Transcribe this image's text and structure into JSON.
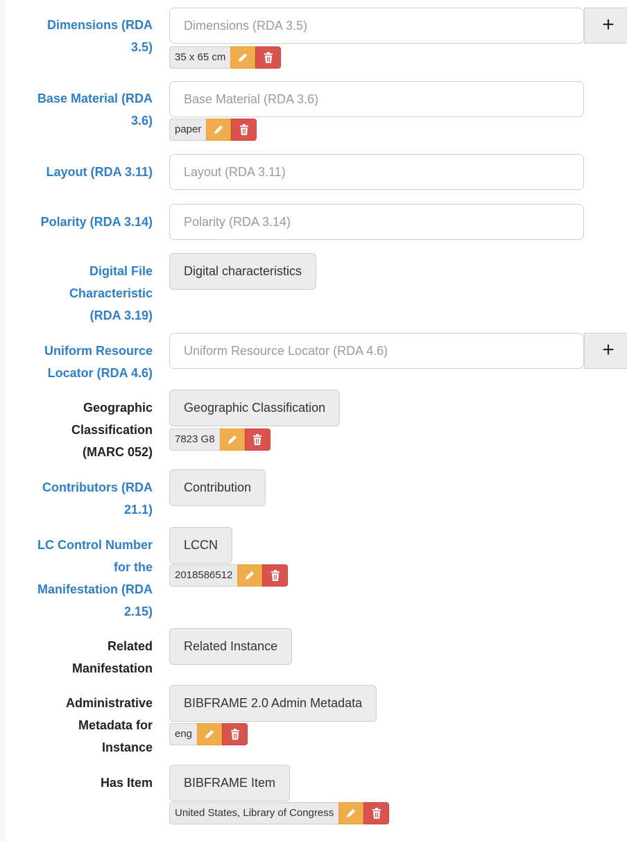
{
  "fields": {
    "dimensions": {
      "label": "Dimensions (RDA\n3.5)",
      "placeholder": "Dimensions (RDA 3.5)",
      "add_icon": "+",
      "tag_value": "35 x 65 cm"
    },
    "base_material": {
      "label": "Base Material (RDA\n3.6)",
      "placeholder": "Base Material (RDA 3.6)",
      "tag_value": "paper"
    },
    "layout": {
      "label": "Layout (RDA 3.11)",
      "placeholder": "Layout (RDA 3.11)"
    },
    "polarity": {
      "label": "Polarity (RDA 3.14)",
      "placeholder": "Polarity (RDA 3.14)"
    },
    "digital_file": {
      "label": "Digital File\nCharacteristic\n(RDA 3.19)",
      "button": "Digital characteristics"
    },
    "url": {
      "label": "Uniform Resource\nLocator (RDA 4.6)",
      "placeholder": "Uniform Resource Locator (RDA 4.6)",
      "add_icon": "+"
    },
    "geographic": {
      "label": "Geographic\nClassification\n(MARC 052)",
      "button": "Geographic Classification",
      "tag_value": "7823 G8"
    },
    "contributors": {
      "label": "Contributors (RDA\n21.1)",
      "button": "Contribution"
    },
    "lccn": {
      "label": "LC Control Number\nfor the\nManifestation (RDA\n2.15)",
      "button": "LCCN",
      "tag_value": "2018586512"
    },
    "related": {
      "label": "Related\nManifestation",
      "button": "Related Instance"
    },
    "admin": {
      "label": "Administrative\nMetadata for\nInstance",
      "button": "BIBFRAME 2.0 Admin Metadata",
      "tag_value": "eng"
    },
    "has_item": {
      "label": "Has Item",
      "button": "BIBFRAME Item",
      "tag_value": "United States, Library of Congress"
    }
  },
  "icons": {
    "add": "plus-icon",
    "edit": "pencil-icon",
    "delete": "trash-icon"
  },
  "colors": {
    "link_label": "#2f7fc8",
    "dark_label": "#222222",
    "edit": "#f0ad4e",
    "delete": "#d9534f"
  }
}
